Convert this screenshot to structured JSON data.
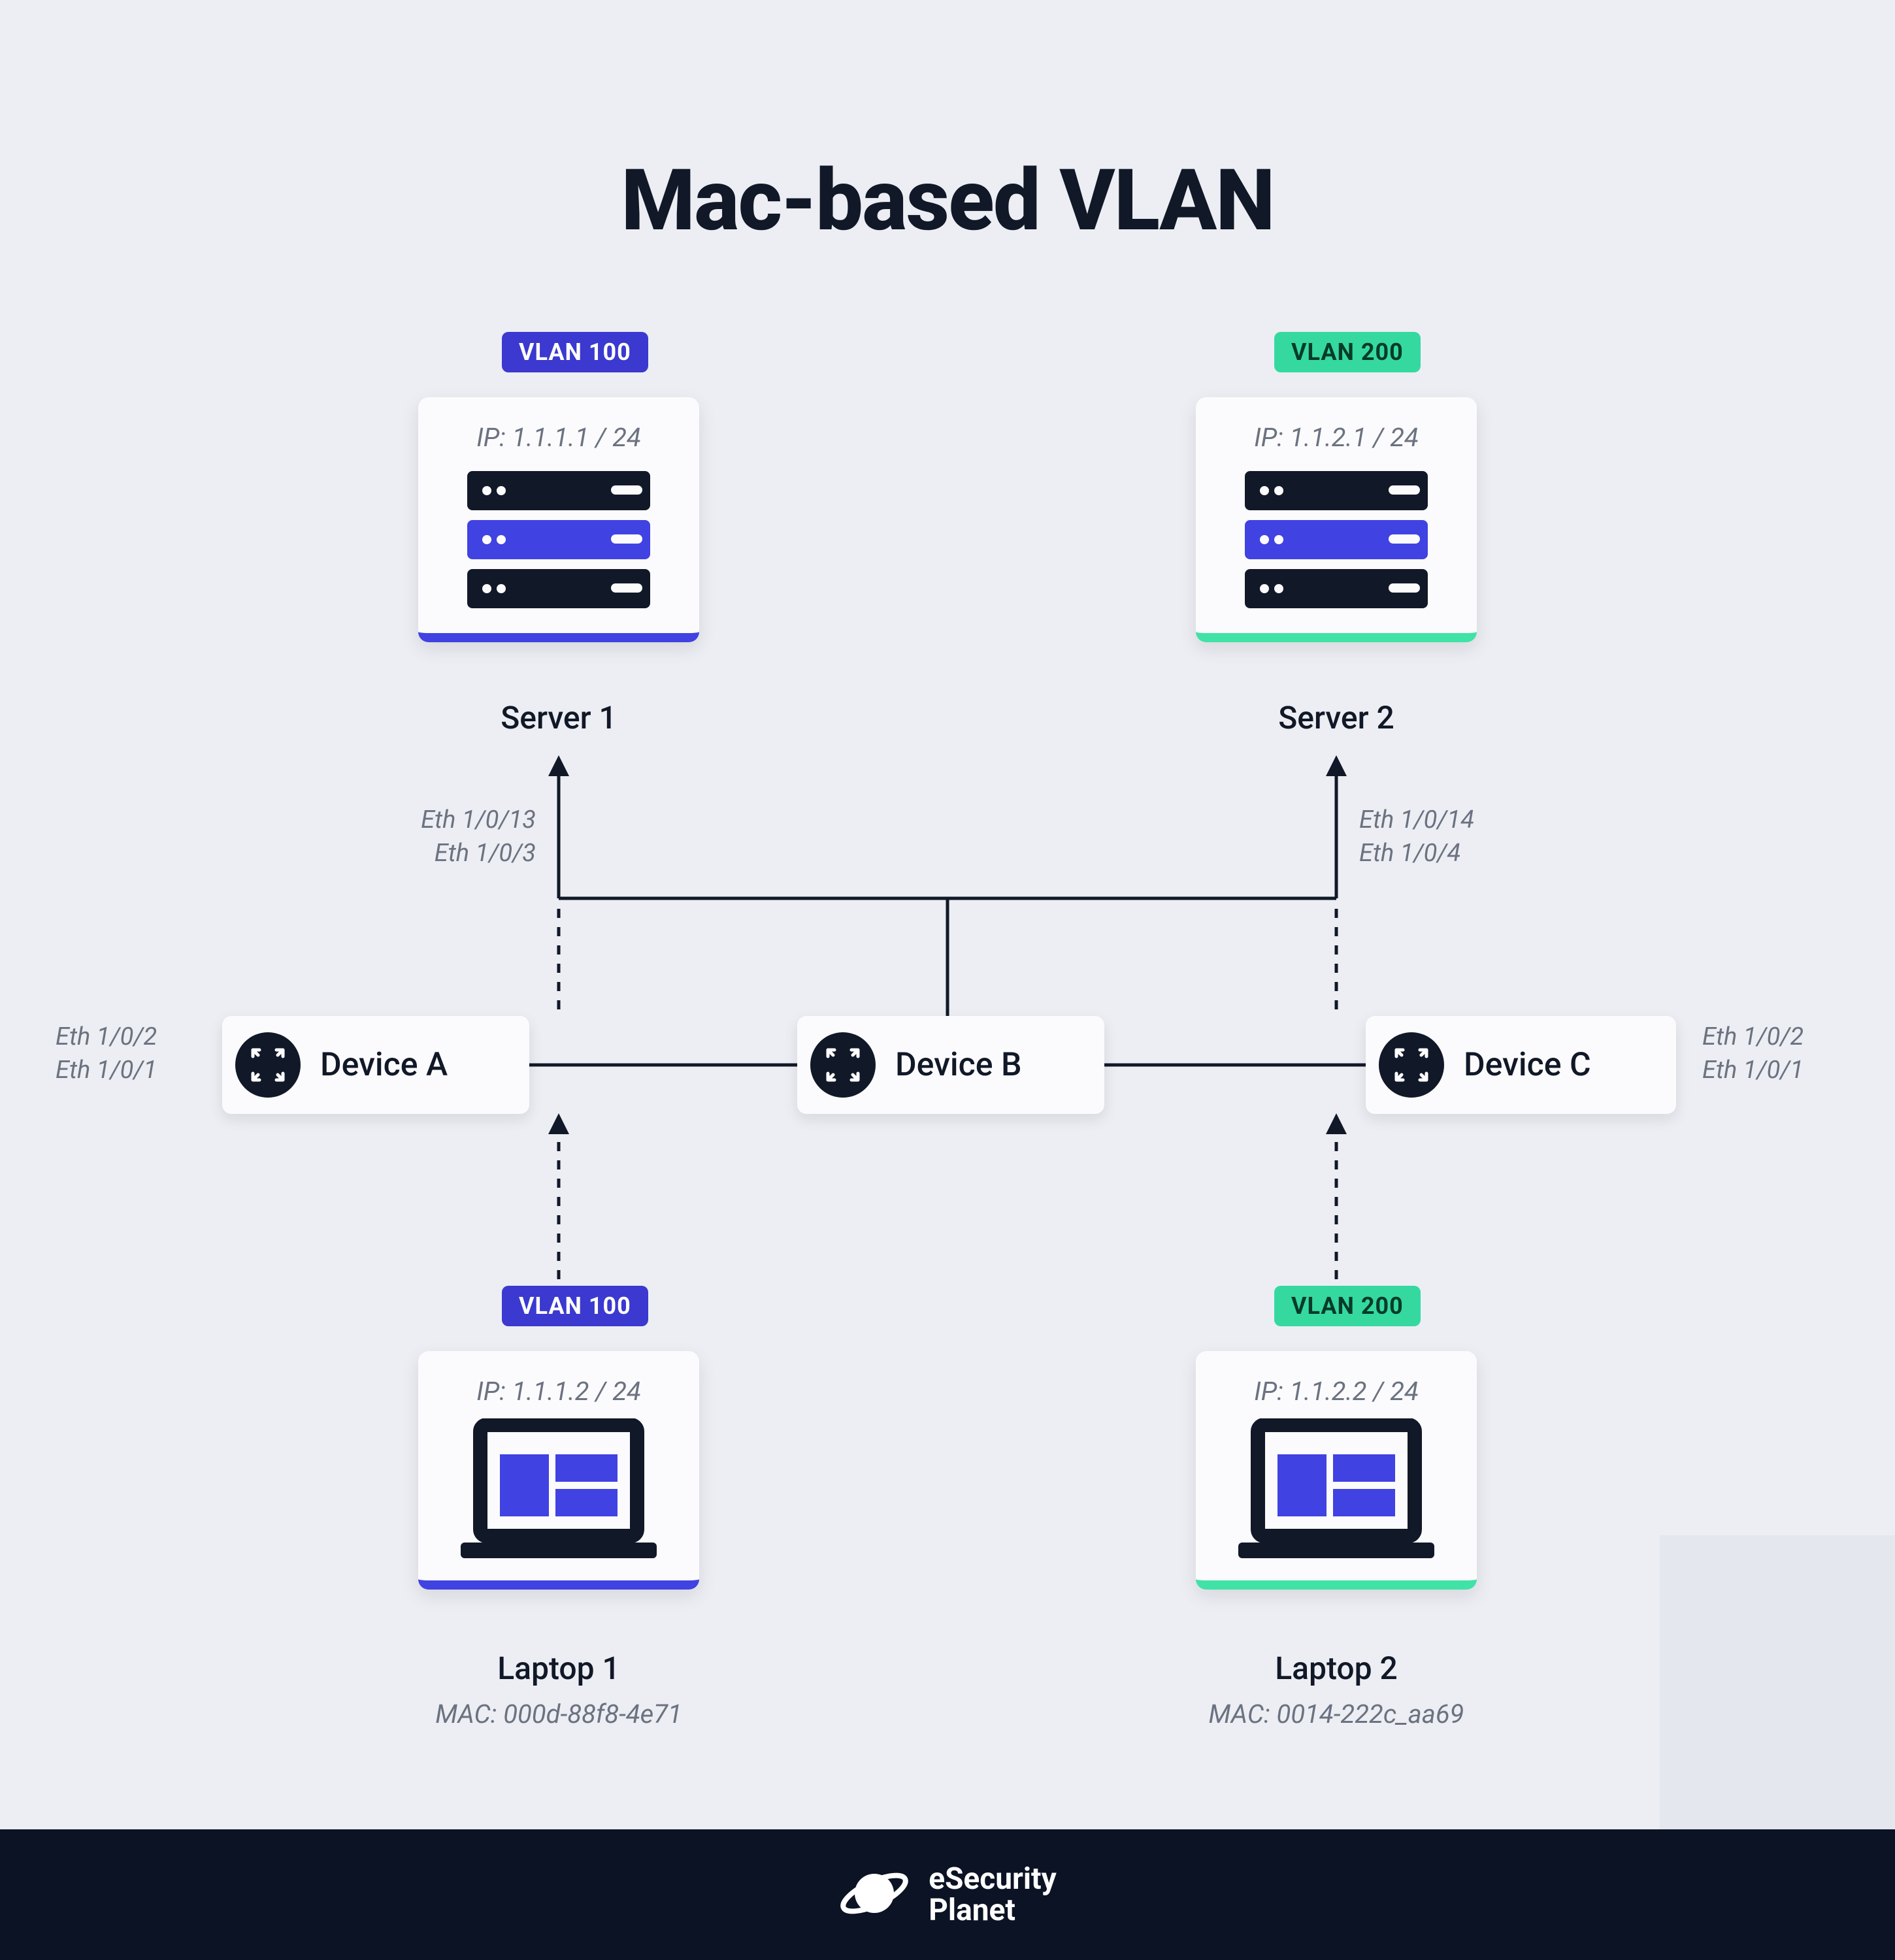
{
  "title": "Mac-based VLAN",
  "colors": {
    "blue": "#4042e2",
    "green": "#40e2a6",
    "dark": "#111827"
  },
  "vlan": {
    "v100": "VLAN 100",
    "v200": "VLAN 200"
  },
  "servers": {
    "s1": {
      "ip": "IP: 1.1.1.1 / 24",
      "label": "Server 1"
    },
    "s2": {
      "ip": "IP: 1.1.2.1 / 24",
      "label": "Server 2"
    }
  },
  "laptops": {
    "l1": {
      "ip": "IP: 1.1.1.2 / 24",
      "label": "Laptop 1",
      "mac": "MAC: 000d-88f8-4e71"
    },
    "l2": {
      "ip": "IP: 1.1.2.2 / 24",
      "label": "Laptop 2",
      "mac": "MAC: 0014-222c_aa69"
    }
  },
  "devices": {
    "a": "Device A",
    "b": "Device B",
    "c": "Device C"
  },
  "ports": {
    "left": "Eth 1/0/2\nEth 1/0/1",
    "right": "Eth 1/0/2\nEth 1/0/1",
    "upL": "Eth 1/0/13\nEth 1/0/3",
    "upR": "Eth 1/0/14\nEth 1/0/4"
  },
  "footer": {
    "brand_top": "eSecurity",
    "brand_bot": "Planet"
  }
}
